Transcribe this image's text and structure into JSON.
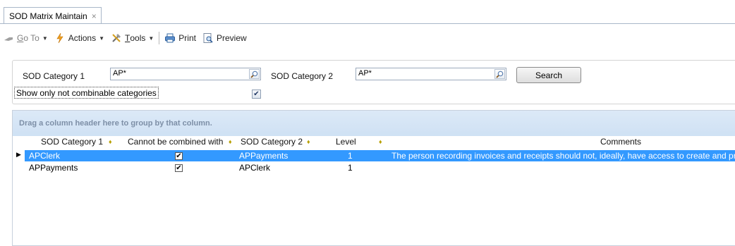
{
  "tab": {
    "title": "SOD Matrix Maintain",
    "close": "×"
  },
  "toolbar": {
    "goto": "Go To",
    "goto_hotkey": "G",
    "actions": "Actions",
    "tools": "Tools",
    "tools_hotkey": "T",
    "print": "Print",
    "preview": "Preview"
  },
  "filter": {
    "cat1_label": "SOD Category 1",
    "cat1_value": "AP*",
    "cat2_label": "SOD Category 2",
    "cat2_value": "AP*",
    "search_label": "Search",
    "only_label": "Show only not combinable categories",
    "only_checked": true
  },
  "grid": {
    "group_hint": "Drag a column header here to group by that column.",
    "headers": {
      "cat1": "SOD Category 1",
      "cannot": "Cannot be combined with",
      "cat2": "SOD Category 2",
      "level": "Level",
      "comments": "Comments"
    },
    "rows": [
      {
        "cat1": "APClerk",
        "cannot": true,
        "cat2": "APPayments",
        "level": "1",
        "comments": "The person recording invoices and receipts should not, ideally, have access to create and process payments."
      },
      {
        "cat1": "APPayments",
        "cannot": true,
        "cat2": "APClerk",
        "level": "1",
        "comments": ""
      }
    ]
  },
  "colors": {
    "selection": "#3399ff",
    "group_bar": "#d6e6f6",
    "border": "#a9b7c9"
  }
}
